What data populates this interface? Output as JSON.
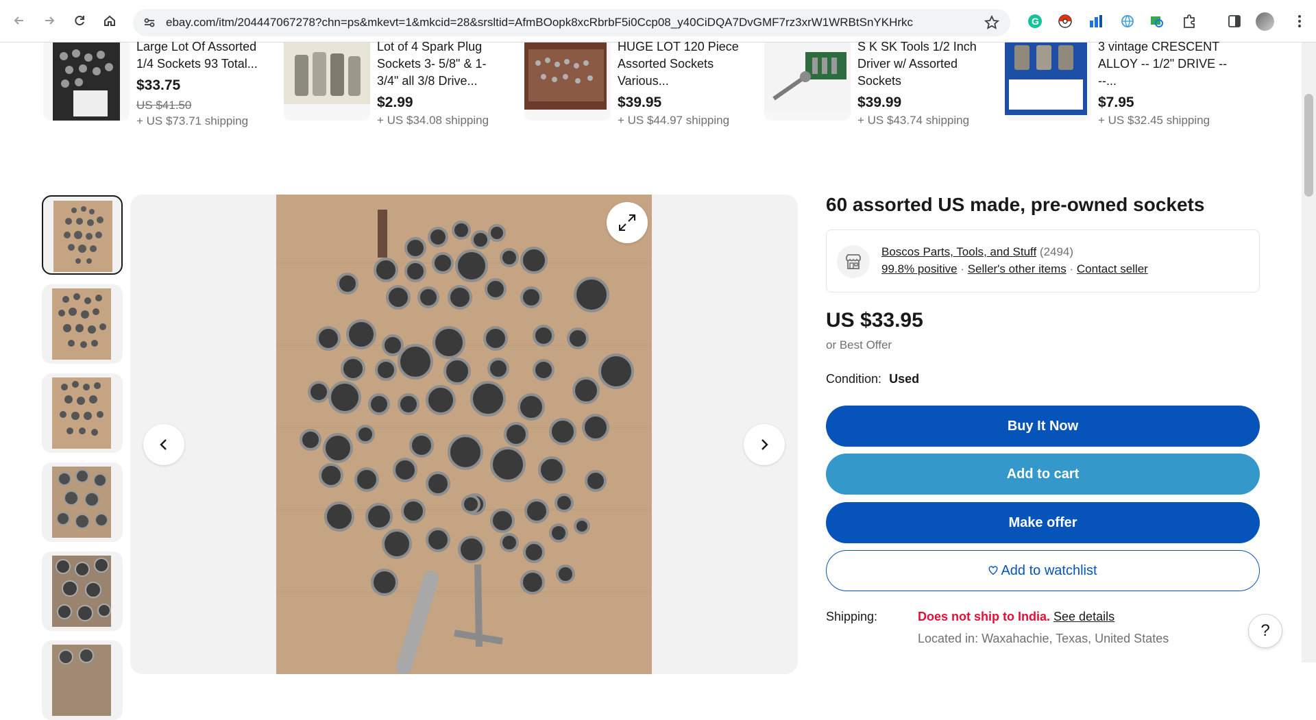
{
  "browser": {
    "url": "ebay.com/itm/204447067278?chn=ps&mkevt=1&mkcid=28&srsltid=AfmBOopk8xcRbrbF5i0Ccp08_y40CiDQA7DvGMF7rz3xrW1WRBtSnYKHrkc"
  },
  "related": [
    {
      "title": "Large Lot Of Assorted 1/4 Sockets 93 Total...",
      "price": "$33.75",
      "old_price": "US $41.50",
      "shipping": "+ US $73.71 shipping"
    },
    {
      "title": "Lot of 4 Spark Plug Sockets 3- 5/8\" & 1- 3/4\" all 3/8 Drive...",
      "price": "$2.99",
      "old_price": "",
      "shipping": "+ US $34.08 shipping"
    },
    {
      "title": "HUGE LOT 120 Piece Assorted Sockets Various...",
      "price": "$39.95",
      "old_price": "",
      "shipping": "+ US $44.97 shipping"
    },
    {
      "title": "S K SK Tools 1/2 Inch Driver w/ Assorted Sockets",
      "price": "$39.99",
      "old_price": "",
      "shipping": "+ US $43.74 shipping"
    },
    {
      "title": "3 vintage CRESCENT ALLOY -- 1/2\" DRIVE ----...",
      "price": "$7.95",
      "old_price": "",
      "shipping": "+ US $32.45 shipping"
    }
  ],
  "item": {
    "title": "60 assorted US made, pre-owned sockets",
    "seller_name": "Boscos Parts, Tools, and Stuff",
    "seller_count": "(2494)",
    "positive": "99.8% positive",
    "other_items": "Seller's other items",
    "contact": "Contact seller",
    "price": "US $33.95",
    "best_offer": "or Best Offer",
    "condition_label": "Condition:",
    "condition_value": "Used",
    "buy_now": "Buy It Now",
    "add_to_cart": "Add to cart",
    "make_offer": "Make offer",
    "watchlist": "Add to watchlist",
    "shipping_label": "Shipping:",
    "shipping_status": "Does not ship to India.",
    "see_details": "See details",
    "located": "Located in: Waxahachie, Texas, United States"
  },
  "help": "?",
  "colors": {
    "primary": "#0654ba",
    "cart": "#3498ca",
    "alert": "#e0103a"
  }
}
